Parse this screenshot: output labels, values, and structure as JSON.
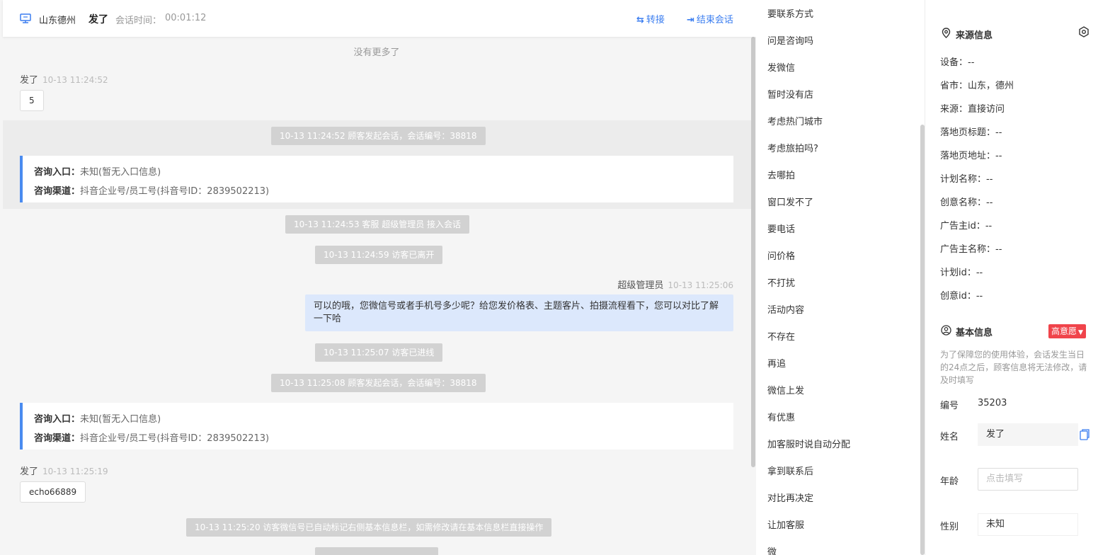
{
  "header": {
    "location": "山东德州",
    "visitor_name": "发了",
    "session_time_label": "会话时间：",
    "session_time": "00:01:12",
    "transfer_label": "转接",
    "end_label": "结束会话"
  },
  "chat": {
    "no_more": "没有更多了",
    "msg1": {
      "sender": "发了",
      "time": "10-13 11:24:52",
      "text": "5"
    },
    "sys1": "10-13 11:24:52 顾客发起会话，会话编号：38818",
    "entry1": {
      "entry_label": "咨询入口：",
      "entry_value": "未知(暂无入口信息)",
      "channel_label": "咨询渠道：",
      "channel_value": "抖音企业号/员工号(抖音号ID：2839502213)"
    },
    "sys2": "10-13 11:24:53 客服 超级管理员 接入会话",
    "sys3": "10-13 11:24:59 访客已离开",
    "agent_msg": {
      "sender": "超级管理员",
      "time": "10-13 11:25:06",
      "text": "可以的哦，您微信号或者手机号多少呢？给您发价格表、主题客片、拍摄流程看下，您可以对比了解一下哈"
    },
    "sys4": "10-13 11:25:07 访客已进线",
    "sys5": "10-13 11:25:08 顾客发起会话，会话编号：38818",
    "entry2": {
      "entry_label": "咨询入口：",
      "entry_value": "未知(暂无入口信息)",
      "channel_label": "咨询渠道：",
      "channel_value": "抖音企业号/员工号(抖音号ID：2839502213)"
    },
    "msg2": {
      "sender": "发了",
      "time": "10-13 11:25:19",
      "text": "echo66889"
    },
    "sys6": "10-13 11:25:20 访客微信号已自动标记右侧基本信息栏，如需修改请在基本信息栏直接操作"
  },
  "quick_replies": [
    "要联系方式",
    "问是咨询吗",
    "发微信",
    "暂时没有店",
    "考虑热门城市",
    "考虑旅拍吗?",
    "去哪拍",
    "窗口发不了",
    "要电话",
    "问价格",
    "不打扰",
    "活动内容",
    "不存在",
    "再追",
    "微信上发",
    "有优惠",
    "加客服时说自动分配",
    "拿到联系后",
    "对比再决定",
    "让加客服",
    "微"
  ],
  "source_info": {
    "title": "来源信息",
    "rows": [
      "设备：--",
      "省市：山东，德州",
      "来源：直接访问",
      "落地页标题：--",
      "落地页地址：--",
      "计划名称：--",
      "创意名称：--",
      "广告主id：--",
      "广告主名称：--",
      "计划id：--",
      "创意id：--"
    ]
  },
  "basic_info": {
    "title": "基本信息",
    "intent_badge": "高意愿",
    "notice": "为了保障您的使用体验，会话发生当日的24点之后，顾客信息将无法修改，请及时填写",
    "id_label": "编号",
    "id_value": "35203",
    "name_label": "姓名",
    "name_value": "发了",
    "age_label": "年龄",
    "age_placeholder": "点击填写",
    "gender_label": "性别",
    "gender_value": "未知"
  },
  "colors": {
    "accent": "#3a7df0",
    "agent_bubble": "#dce8fc",
    "entry_bar": "#4a8bf0",
    "badge": "#f0444b"
  }
}
